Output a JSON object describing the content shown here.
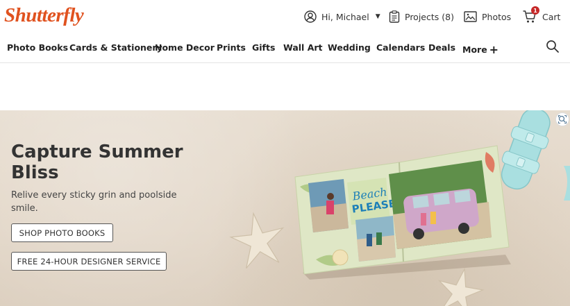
{
  "brand": {
    "logo": "Shutterfly",
    "accent": "#e0521f"
  },
  "utility": {
    "account_label": "Hi, Michael",
    "projects_label": "Projects (8)",
    "photos_label": "Photos",
    "cart_label": "Cart",
    "cart_count": "1"
  },
  "nav": {
    "items": [
      "Photo Books",
      "Cards & Stationery",
      "Home Decor",
      "Prints",
      "Gifts",
      "Wall Art",
      "Wedding",
      "Calendars",
      "Deals",
      "More"
    ]
  },
  "hero": {
    "title": "Capture Summer Bliss",
    "subtitle": "Relive every sticky grin and poolside smile.",
    "primary_button": "SHOP PHOTO BOOKS",
    "secondary_button": "FREE 24-HOUR DESIGNER SERVICE",
    "book_text_line1": "Beach",
    "book_text_line2": "PLEASE"
  },
  "icons": {
    "account": "user-circle-icon",
    "projects": "clipboard-icon",
    "photos": "image-icon",
    "cart": "cart-icon",
    "search": "search-icon",
    "more": "plus-icon",
    "zoom": "zoom-icon"
  }
}
